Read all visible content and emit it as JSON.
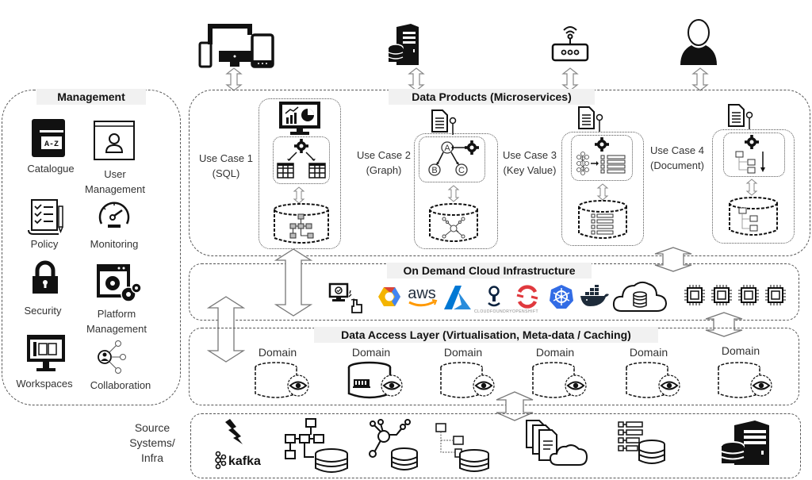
{
  "top_consumers": [
    {
      "name": "devices",
      "icon": "multi-device-icon"
    },
    {
      "name": "server",
      "icon": "server-database-icon"
    },
    {
      "name": "iot-router",
      "icon": "router-wifi-icon"
    },
    {
      "name": "user",
      "icon": "user-silhouette-icon"
    }
  ],
  "management": {
    "title": "Management",
    "items": [
      {
        "label": "Catalogue",
        "icon": "catalogue-book-icon"
      },
      {
        "label": "User Management",
        "icon": "user-window-icon"
      },
      {
        "label": "Policy",
        "icon": "policy-checklist-icon"
      },
      {
        "label": "Monitoring",
        "icon": "gauge-icon"
      },
      {
        "label": "Security",
        "icon": "padlock-icon"
      },
      {
        "label": "Platform Management",
        "icon": "platform-gears-icon"
      },
      {
        "label": "Workspaces",
        "icon": "workspace-monitor-icon"
      },
      {
        "label": "Collaboration",
        "icon": "collaboration-network-icon"
      }
    ]
  },
  "data_products": {
    "title": "Data Products (Microservices)",
    "use_cases": [
      {
        "line1": "Use Case 1",
        "line2": "(SQL)"
      },
      {
        "line1": "Use Case 2",
        "line2": "(Graph)",
        "nodes": [
          "A",
          "B",
          "C"
        ]
      },
      {
        "line1": "Use Case 3",
        "line2": "(Key Value)"
      },
      {
        "line1": "Use Case 4",
        "line2": "(Document)"
      }
    ]
  },
  "cloud_infra": {
    "title": "On Demand Cloud Infrastructure",
    "providers": [
      "self-service",
      "Google Cloud",
      "aws",
      "Azure",
      "Cloud Foundry",
      "OpenShift",
      "Kubernetes",
      "Docker",
      "cloud-storage"
    ],
    "aws_text": "aws",
    "cloudfoundry_text": "CLOUDFOUNDRY",
    "openshift_text": "OPENSHIFT",
    "chip_count": 4
  },
  "data_access": {
    "title": "Data Access Layer (Virtualisation, Meta-data / Caching)",
    "domains": [
      "Domain",
      "Domain",
      "Domain",
      "Domain",
      "Domain",
      "Domain"
    ]
  },
  "source_systems": {
    "label_lines": [
      "Source",
      "Systems/",
      "Infra"
    ],
    "kafka_text": "kafka",
    "sources": [
      "streaming-kafka",
      "relational-db",
      "graph-db",
      "hierarchical-db",
      "documents-cloud",
      "key-value-db",
      "server-db"
    ]
  },
  "colors": {
    "google_yellow": "#f4b400",
    "google_red": "#db4437",
    "google_blue": "#4285f4",
    "aws_text": "#232f3e",
    "aws_smile": "#ff9900",
    "azure": "#0078d4",
    "openshift": "#e0393e",
    "kubernetes": "#326ce5",
    "docker": "#1d2b3a"
  }
}
